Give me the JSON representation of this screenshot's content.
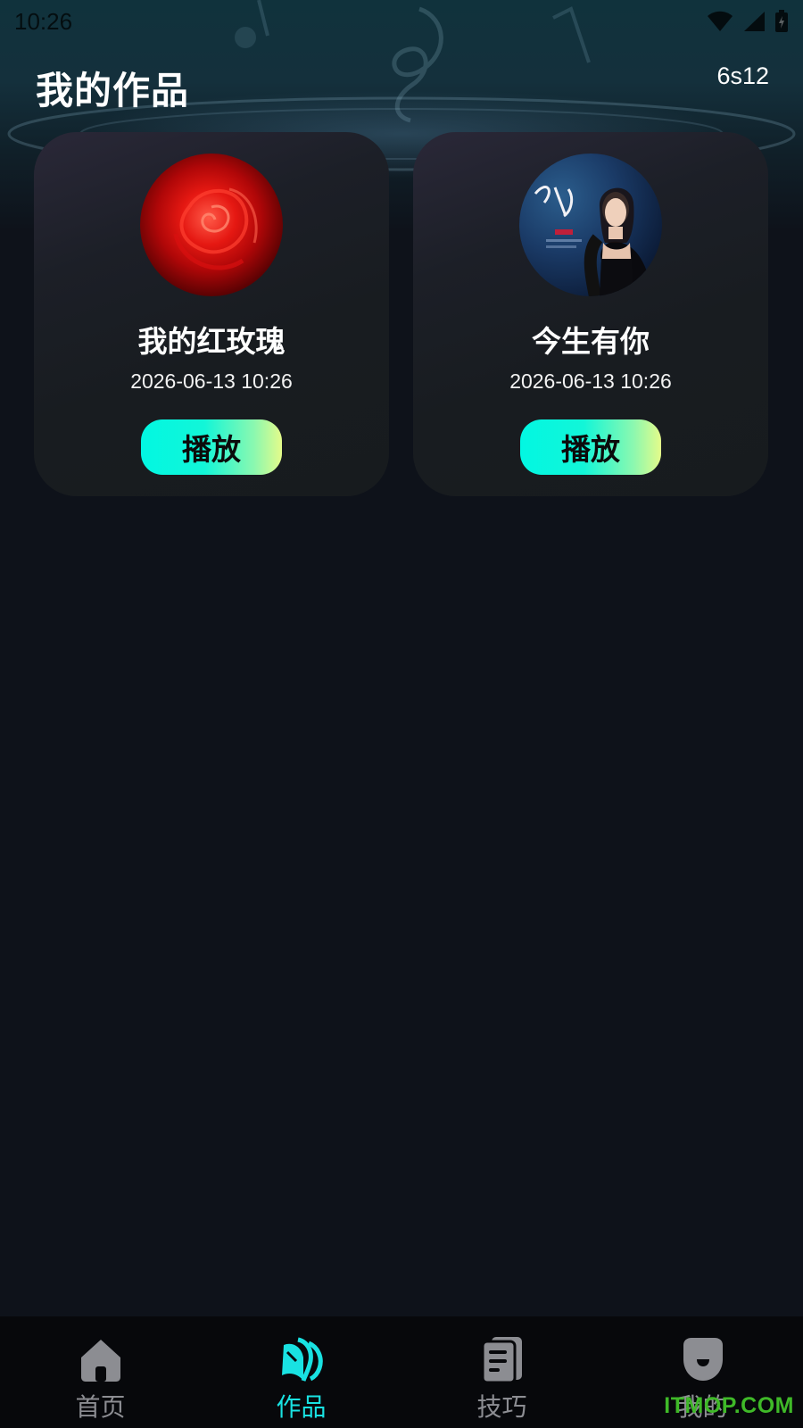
{
  "status_bar": {
    "time": "10:26"
  },
  "header": {
    "title": "我的作品",
    "right_text": "6s12"
  },
  "works": [
    {
      "title": "我的红玫瑰",
      "date": "2026-06-13 10:26",
      "play_label": "播放",
      "cover": "red-rose-cover"
    },
    {
      "title": "今生有你",
      "date": "2026-06-13 10:26",
      "play_label": "播放",
      "cover": "singer-album-cover"
    }
  ],
  "tabs": [
    {
      "label": "首页",
      "icon": "home-icon",
      "active": false
    },
    {
      "label": "作品",
      "icon": "works-icon",
      "active": true
    },
    {
      "label": "技巧",
      "icon": "tips-icon",
      "active": false
    },
    {
      "label": "我的",
      "icon": "profile-icon",
      "active": false
    }
  ],
  "watermark": "ITMOP.COM",
  "colors": {
    "accent": "#19e2e2",
    "background": "#0e121a",
    "tab_inactive": "#8c8d92",
    "button_gradient_start": "#02f7e2",
    "button_gradient_end": "#e4fb8a"
  }
}
